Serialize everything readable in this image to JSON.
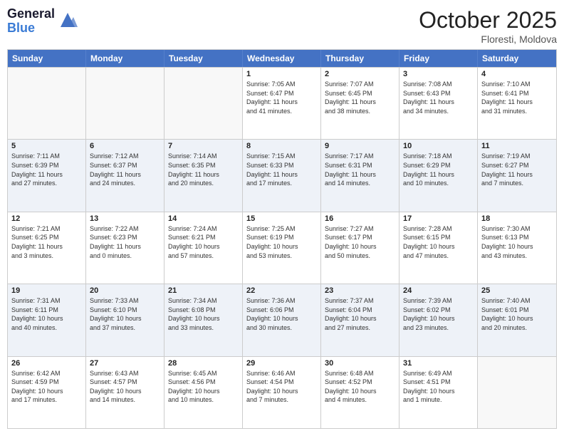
{
  "header": {
    "logo_general": "General",
    "logo_blue": "Blue",
    "month_title": "October 2025",
    "subtitle": "Floresti, Moldova"
  },
  "day_headers": [
    "Sunday",
    "Monday",
    "Tuesday",
    "Wednesday",
    "Thursday",
    "Friday",
    "Saturday"
  ],
  "weeks": [
    [
      {
        "day": "",
        "info": ""
      },
      {
        "day": "",
        "info": ""
      },
      {
        "day": "",
        "info": ""
      },
      {
        "day": "1",
        "info": "Sunrise: 7:05 AM\nSunset: 6:47 PM\nDaylight: 11 hours\nand 41 minutes."
      },
      {
        "day": "2",
        "info": "Sunrise: 7:07 AM\nSunset: 6:45 PM\nDaylight: 11 hours\nand 38 minutes."
      },
      {
        "day": "3",
        "info": "Sunrise: 7:08 AM\nSunset: 6:43 PM\nDaylight: 11 hours\nand 34 minutes."
      },
      {
        "day": "4",
        "info": "Sunrise: 7:10 AM\nSunset: 6:41 PM\nDaylight: 11 hours\nand 31 minutes."
      }
    ],
    [
      {
        "day": "5",
        "info": "Sunrise: 7:11 AM\nSunset: 6:39 PM\nDaylight: 11 hours\nand 27 minutes."
      },
      {
        "day": "6",
        "info": "Sunrise: 7:12 AM\nSunset: 6:37 PM\nDaylight: 11 hours\nand 24 minutes."
      },
      {
        "day": "7",
        "info": "Sunrise: 7:14 AM\nSunset: 6:35 PM\nDaylight: 11 hours\nand 20 minutes."
      },
      {
        "day": "8",
        "info": "Sunrise: 7:15 AM\nSunset: 6:33 PM\nDaylight: 11 hours\nand 17 minutes."
      },
      {
        "day": "9",
        "info": "Sunrise: 7:17 AM\nSunset: 6:31 PM\nDaylight: 11 hours\nand 14 minutes."
      },
      {
        "day": "10",
        "info": "Sunrise: 7:18 AM\nSunset: 6:29 PM\nDaylight: 11 hours\nand 10 minutes."
      },
      {
        "day": "11",
        "info": "Sunrise: 7:19 AM\nSunset: 6:27 PM\nDaylight: 11 hours\nand 7 minutes."
      }
    ],
    [
      {
        "day": "12",
        "info": "Sunrise: 7:21 AM\nSunset: 6:25 PM\nDaylight: 11 hours\nand 3 minutes."
      },
      {
        "day": "13",
        "info": "Sunrise: 7:22 AM\nSunset: 6:23 PM\nDaylight: 11 hours\nand 0 minutes."
      },
      {
        "day": "14",
        "info": "Sunrise: 7:24 AM\nSunset: 6:21 PM\nDaylight: 10 hours\nand 57 minutes."
      },
      {
        "day": "15",
        "info": "Sunrise: 7:25 AM\nSunset: 6:19 PM\nDaylight: 10 hours\nand 53 minutes."
      },
      {
        "day": "16",
        "info": "Sunrise: 7:27 AM\nSunset: 6:17 PM\nDaylight: 10 hours\nand 50 minutes."
      },
      {
        "day": "17",
        "info": "Sunrise: 7:28 AM\nSunset: 6:15 PM\nDaylight: 10 hours\nand 47 minutes."
      },
      {
        "day": "18",
        "info": "Sunrise: 7:30 AM\nSunset: 6:13 PM\nDaylight: 10 hours\nand 43 minutes."
      }
    ],
    [
      {
        "day": "19",
        "info": "Sunrise: 7:31 AM\nSunset: 6:11 PM\nDaylight: 10 hours\nand 40 minutes."
      },
      {
        "day": "20",
        "info": "Sunrise: 7:33 AM\nSunset: 6:10 PM\nDaylight: 10 hours\nand 37 minutes."
      },
      {
        "day": "21",
        "info": "Sunrise: 7:34 AM\nSunset: 6:08 PM\nDaylight: 10 hours\nand 33 minutes."
      },
      {
        "day": "22",
        "info": "Sunrise: 7:36 AM\nSunset: 6:06 PM\nDaylight: 10 hours\nand 30 minutes."
      },
      {
        "day": "23",
        "info": "Sunrise: 7:37 AM\nSunset: 6:04 PM\nDaylight: 10 hours\nand 27 minutes."
      },
      {
        "day": "24",
        "info": "Sunrise: 7:39 AM\nSunset: 6:02 PM\nDaylight: 10 hours\nand 23 minutes."
      },
      {
        "day": "25",
        "info": "Sunrise: 7:40 AM\nSunset: 6:01 PM\nDaylight: 10 hours\nand 20 minutes."
      }
    ],
    [
      {
        "day": "26",
        "info": "Sunrise: 6:42 AM\nSunset: 4:59 PM\nDaylight: 10 hours\nand 17 minutes."
      },
      {
        "day": "27",
        "info": "Sunrise: 6:43 AM\nSunset: 4:57 PM\nDaylight: 10 hours\nand 14 minutes."
      },
      {
        "day": "28",
        "info": "Sunrise: 6:45 AM\nSunset: 4:56 PM\nDaylight: 10 hours\nand 10 minutes."
      },
      {
        "day": "29",
        "info": "Sunrise: 6:46 AM\nSunset: 4:54 PM\nDaylight: 10 hours\nand 7 minutes."
      },
      {
        "day": "30",
        "info": "Sunrise: 6:48 AM\nSunset: 4:52 PM\nDaylight: 10 hours\nand 4 minutes."
      },
      {
        "day": "31",
        "info": "Sunrise: 6:49 AM\nSunset: 4:51 PM\nDaylight: 10 hours\nand 1 minute."
      },
      {
        "day": "",
        "info": ""
      }
    ]
  ]
}
